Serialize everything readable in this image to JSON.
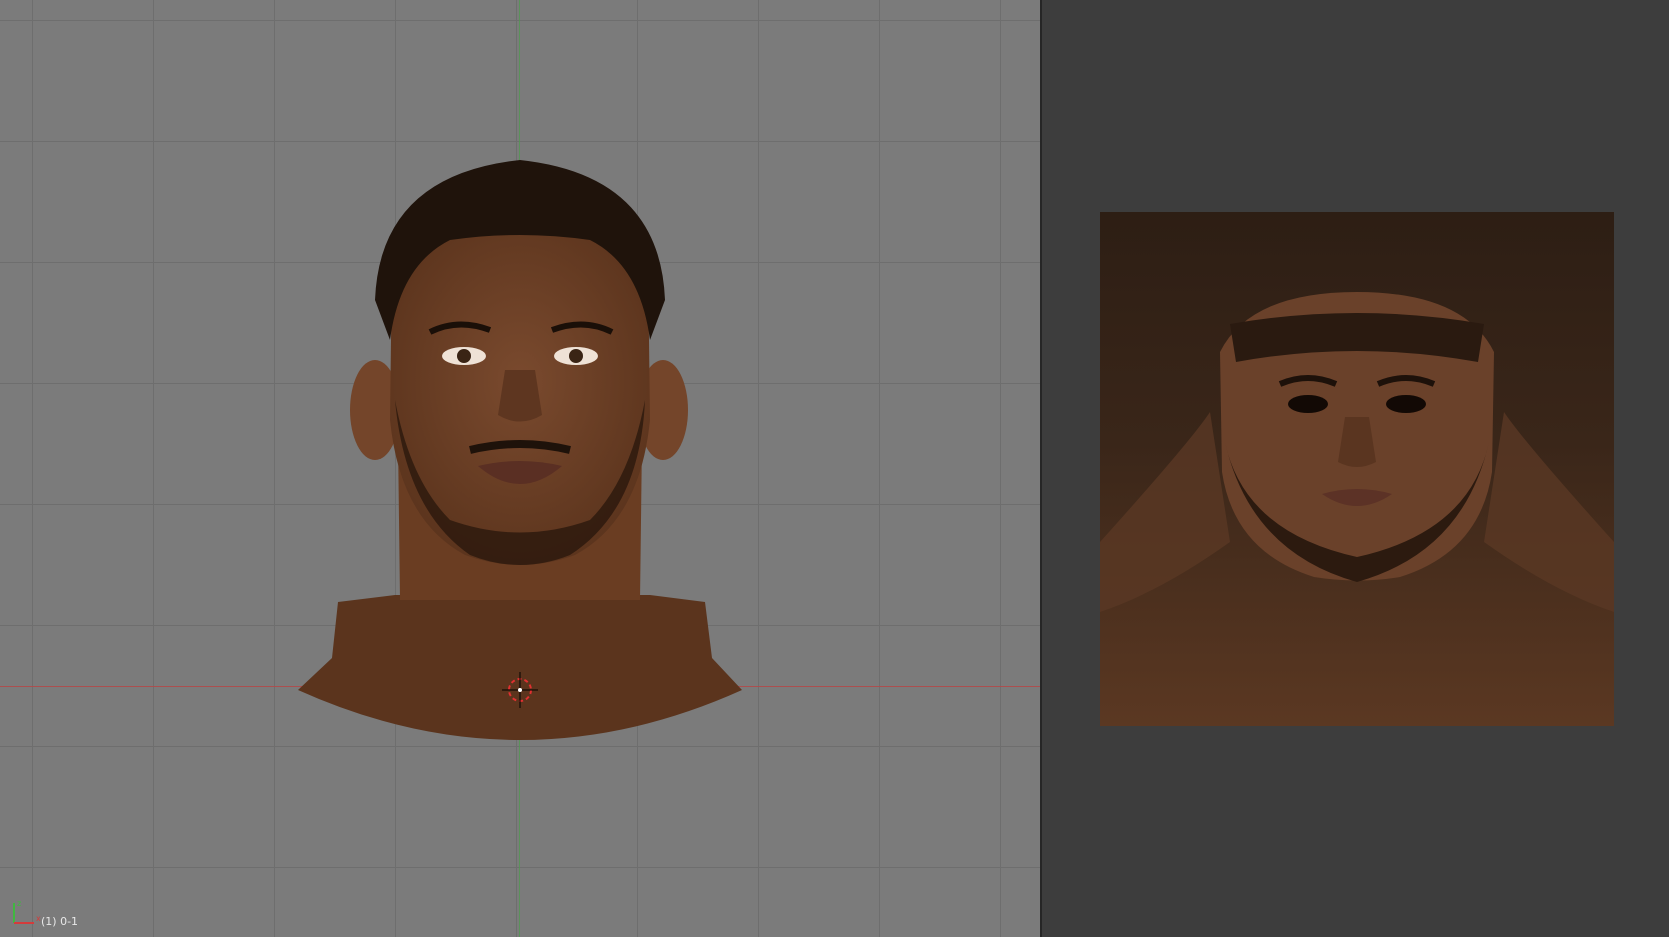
{
  "viewport": {
    "frame_label": "(1) 0-1",
    "colors": {
      "background": "#7b7b7b",
      "grid": "#6e6e6e",
      "x_axis": "#b54848",
      "y_axis": "#4f9a4f"
    }
  },
  "uv_editor": {
    "colors": {
      "background": "#3d3d3d"
    }
  },
  "icons": {
    "cursor": "3d-cursor-icon",
    "axes": "axes-gizmo-icon"
  }
}
